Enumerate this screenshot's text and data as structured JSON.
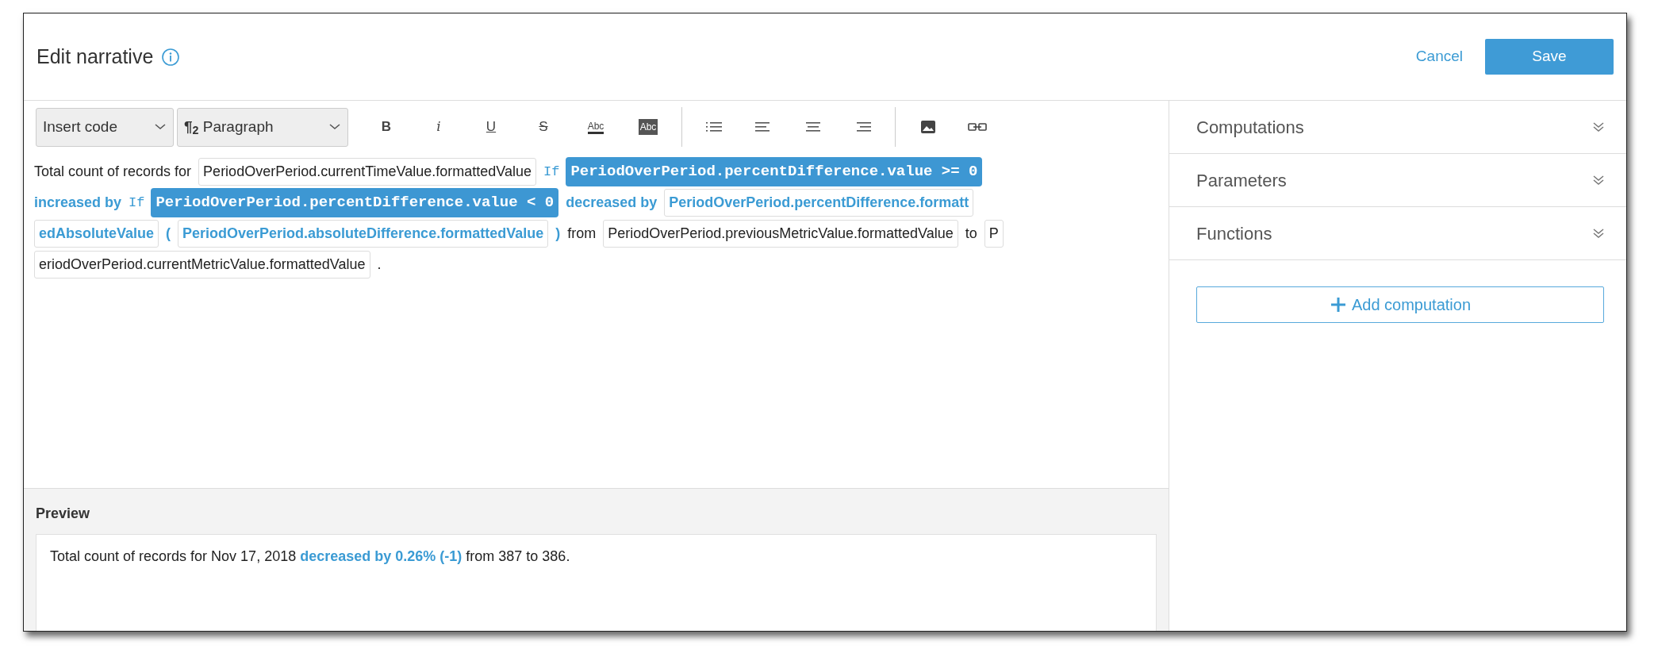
{
  "header": {
    "title": "Edit narrative",
    "cancel": "Cancel",
    "save": "Save"
  },
  "toolbar": {
    "insert_code": "Insert code",
    "style_mark": "¶$_{2}$",
    "style": "Paragraph",
    "format_buttons": [
      {
        "kind": "bold",
        "label": "B"
      },
      {
        "kind": "italic",
        "label": "i"
      },
      {
        "kind": "underline",
        "label": "U"
      },
      {
        "kind": "strike",
        "label": "S"
      },
      {
        "kind": "color",
        "label": "Abc"
      },
      {
        "kind": "highlight",
        "label": "Abc"
      }
    ]
  },
  "narrative": [
    [
      {
        "kind": "text",
        "text": "Total count of records for"
      },
      {
        "kind": "code",
        "text": "PeriodOverPeriod.currentTimeValue.formattedValue"
      },
      {
        "kind": "cond",
        "keyword": "If",
        "text": "PeriodOverPeriod.percentDifference.value >= 0"
      }
    ],
    [
      {
        "kind": "blue",
        "text": "increased by"
      },
      {
        "kind": "cond",
        "keyword": "If",
        "text": "PeriodOverPeriod.percentDifference.value < 0"
      },
      {
        "kind": "blue",
        "text": "decreased by"
      },
      {
        "kind": "bluecode",
        "text": "PeriodOverPeriod.percentDifference.formatt"
      }
    ],
    [
      {
        "kind": "bluecode",
        "text": "edAbsoluteValue"
      },
      {
        "kind": "blue",
        "text": "("
      },
      {
        "kind": "bluecode",
        "text": "PeriodOverPeriod.absoluteDifference.formattedValue"
      },
      {
        "kind": "blue",
        "text": ")"
      },
      {
        "kind": "text",
        "text": "from"
      },
      {
        "kind": "code",
        "text": "PeriodOverPeriod.previousMetricValue.formattedValue"
      },
      {
        "kind": "text",
        "text": "to"
      },
      {
        "kind": "code",
        "text": "P"
      }
    ],
    [
      {
        "kind": "code",
        "text": "eriodOverPeriod.currentMetricValue.formattedValue"
      },
      {
        "kind": "text",
        "text": "."
      }
    ]
  ],
  "preview": {
    "title": "Preview",
    "parts": [
      {
        "kind": "text",
        "text": "Total count of records for Nov 17, 2018 "
      },
      {
        "kind": "highlight",
        "text": "decreased by 0.26% (-1)"
      },
      {
        "kind": "text",
        "text": " from 387 to 386."
      }
    ]
  },
  "sections": [
    {
      "label": "Computations",
      "expanded": false
    },
    {
      "label": "Parameters",
      "expanded": false
    },
    {
      "label": "Functions",
      "expanded": false
    }
  ],
  "add_button": "Add computation"
}
